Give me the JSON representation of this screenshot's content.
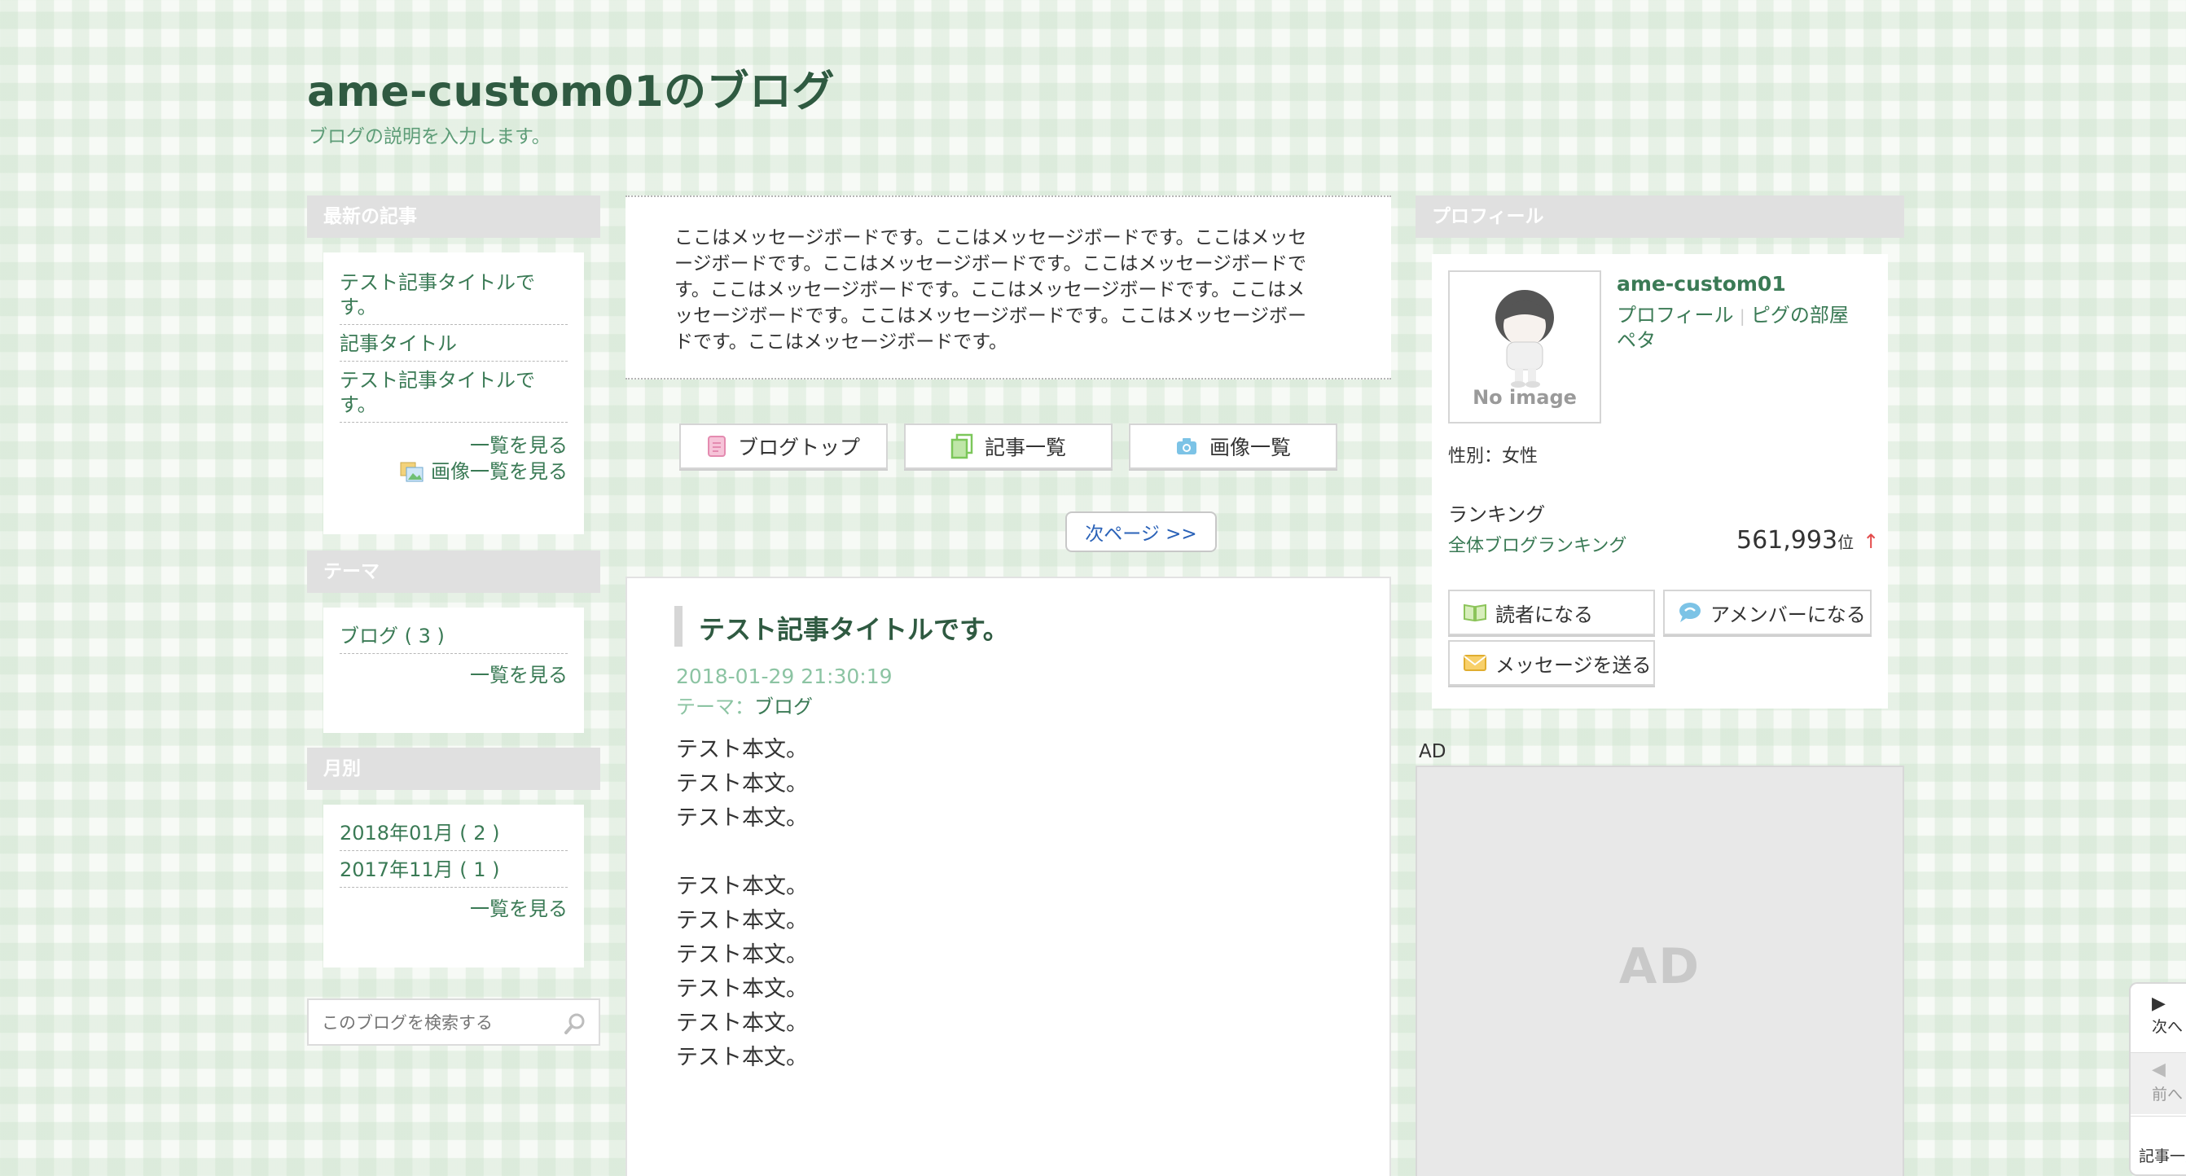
{
  "header": {
    "title": "ame-custom01のブログ",
    "description": "ブログの説明を入力します。"
  },
  "sidebar": {
    "recent": {
      "heading": "最新の記事",
      "items": [
        {
          "line1": "テスト記事タイトルで",
          "line2": "す。"
        },
        {
          "line1": "記事タイトル",
          "line2": ""
        },
        {
          "line1": "テスト記事タイトルで",
          "line2": "す。"
        }
      ],
      "more_label": "一覧を見る",
      "images_label": "画像一覧を見る"
    },
    "theme": {
      "heading": "テーマ",
      "items": [
        "ブログ ( 3 )"
      ],
      "more_label": "一覧を見る"
    },
    "monthly": {
      "heading": "月別",
      "items": [
        "2018年01月 ( 2 )",
        "2017年11月 ( 1 )"
      ],
      "more_label": "一覧を見る"
    },
    "search": {
      "placeholder": "このブログを検索する"
    }
  },
  "message_board": {
    "lines": [
      "ここはメッセージボードです。ここはメッセージボードです。ここはメッセ",
      "ージボードです。ここはメッセージボードです。ここはメッセージボードで",
      "す。ここはメッセージボードです。ここはメッセージボードです。ここはメ",
      "ッセージボードです。ここはメッセージボードです。ここはメッセージボー",
      "ドです。ここはメッセージボードです。"
    ]
  },
  "nav": {
    "blog_top": "ブログトップ",
    "article_list": "記事一覧",
    "image_list": "画像一覧",
    "next_page": "次ページ >>"
  },
  "article": {
    "title": "テスト記事タイトルです。",
    "date": "2018-01-29 21:30:19",
    "theme_prefix": "テーマ：",
    "theme_name": "ブログ",
    "body_lines": [
      "テスト本文。",
      "テスト本文。",
      "テスト本文。",
      "",
      "テスト本文。",
      "テスト本文。",
      "テスト本文。",
      "テスト本文。",
      "テスト本文。",
      "テスト本文。"
    ]
  },
  "profile": {
    "heading": "プロフィール",
    "username": "ame-custom01",
    "link_profile": "プロフィール",
    "link_pigg": "ピグの部屋",
    "link_peta": "ペタ",
    "separator": "|",
    "no_image": "No image",
    "gender": "性別：女性",
    "ranking_label": "ランキング",
    "ranking_link": "全体ブログランキング",
    "rank_value": "561,993",
    "rank_unit": "位",
    "rank_trend": "↑",
    "btn_reader": "読者になる",
    "btn_amember": "アメンバーになる",
    "btn_message": "メッセージを送る"
  },
  "ad": {
    "label": "AD",
    "placeholder": "AD"
  },
  "pager": {
    "next": "次へ",
    "prev": "前へ",
    "list": "記事一覧"
  },
  "colors": {
    "title_green": "#2f5a41",
    "link_green": "#3a7a55",
    "date_green": "#8cc4a3",
    "next_link_blue": "#2a62b8",
    "rank_arrow_red": "#e34b4b"
  }
}
